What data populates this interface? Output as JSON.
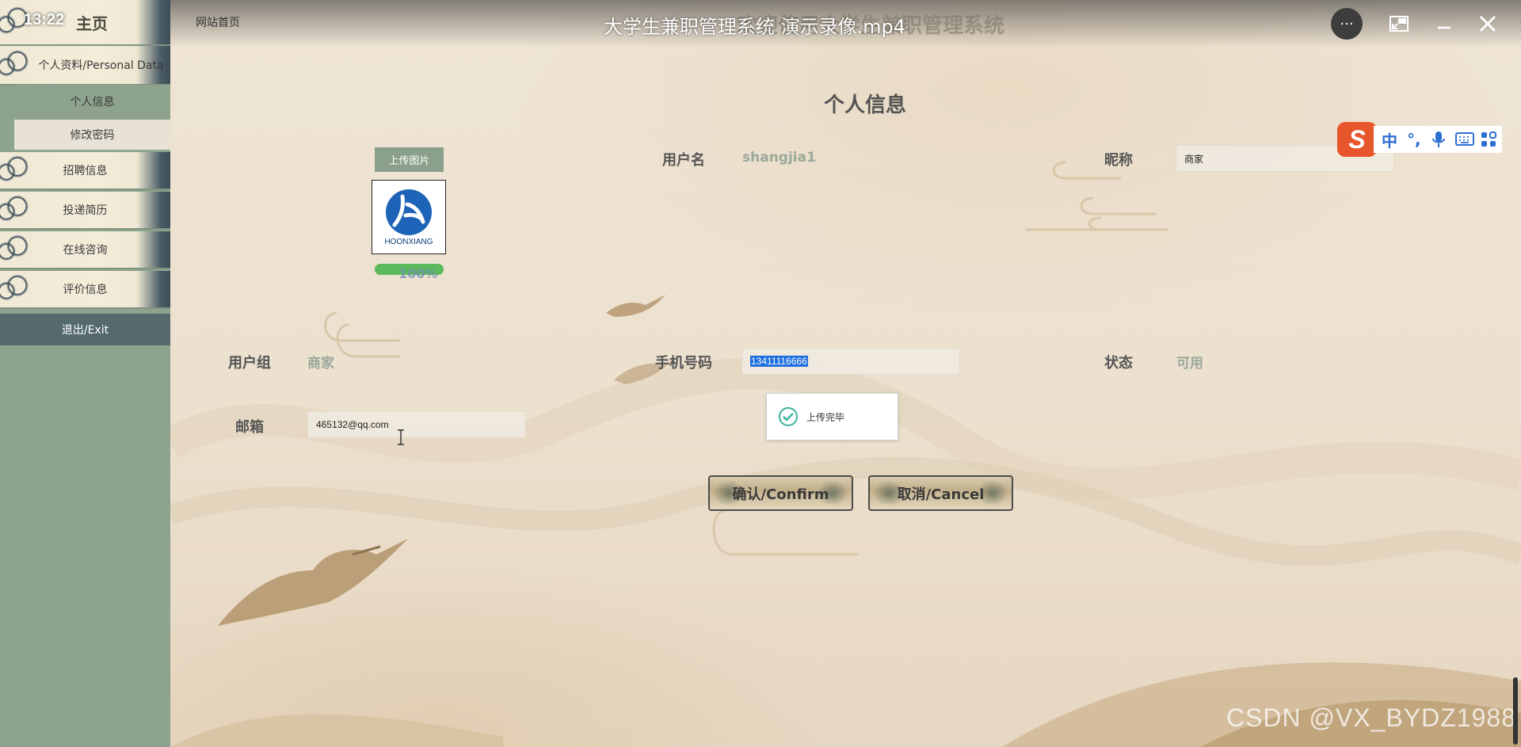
{
  "player": {
    "clock": "13:22",
    "title": "大学生兼职管理系统 演示录像.mp4",
    "more_label": "···",
    "watermark": "CSDN @VX_BYDZ1988"
  },
  "site": {
    "home_link": "网站首页",
    "ghost_header": "欢迎使用大学生兼职管理系统"
  },
  "sidebar": {
    "home": "主页",
    "personal_section": "个人资料/Personal Data",
    "sub_items": [
      "个人信息",
      "修改密码"
    ],
    "items": [
      "招聘信息",
      "投递简历",
      "在线咨询",
      "评价信息"
    ],
    "exit": "退出/Exit"
  },
  "form": {
    "title": "个人信息",
    "upload_button": "上传图片",
    "avatar_brand": "HOONXIANG",
    "progress_label": "100%",
    "progress": 1.0,
    "username_label": "用户名",
    "username_value": "shangjia1",
    "nickname_label": "昵称",
    "nickname_value": "商家",
    "group_label": "用户组",
    "group_value": "商家",
    "phone_label": "手机号码",
    "phone_value": "13411116666",
    "status_label": "状态",
    "status_value": "可用",
    "email_label": "邮箱",
    "email_value": "465132@qq.com",
    "confirm_button": "确认/Confirm",
    "cancel_button": "取消/Cancel"
  },
  "toast": {
    "message": "上传完毕"
  },
  "ime": {
    "logo": "S",
    "items": [
      "中",
      "°,"
    ]
  },
  "colors": {
    "sidebar_bg": "#8ea38d",
    "exit_bg": "#546a6f",
    "upload_btn": "#8aa08a",
    "progress": "#5cb85c",
    "selection": "#1e6fe0",
    "ime_logo": "#e8562b"
  }
}
